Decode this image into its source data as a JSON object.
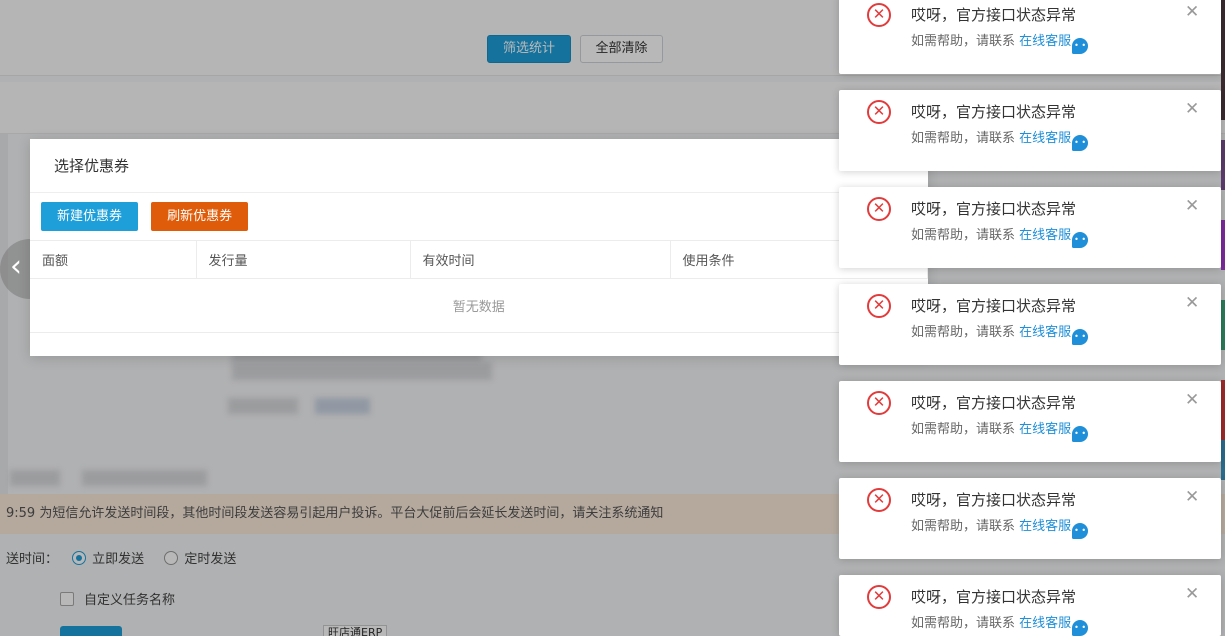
{
  "background": {
    "filter_button": "筛选统计",
    "clear_button": "全部清除",
    "notice_text": "9:59 为短信允许发送时间段，其他时间段发送容易引起用户投诉。平台大促前后会延长发送时间，请关注系统通知",
    "send_time_label": "送时间：",
    "send_now": "立即发送",
    "send_scheduled": "定时发送",
    "custom_task_name": "自定义任务名称",
    "erp_tag": "旺店通ERP"
  },
  "dialog": {
    "title": "选择优惠券",
    "new_button": "新建优惠券",
    "refresh_button": "刷新优惠券",
    "columns": [
      "面额",
      "发行量",
      "有效时间",
      "使用条件"
    ],
    "empty_text": "暂无数据"
  },
  "toasts": [
    {
      "title": "哎呀，官方接口状态异常",
      "help": "如需帮助，请联系",
      "link": "在线客服"
    },
    {
      "title": "哎呀，官方接口状态异常",
      "help": "如需帮助，请联系",
      "link": "在线客服"
    },
    {
      "title": "哎呀，官方接口状态异常",
      "help": "如需帮助，请联系",
      "link": "在线客服"
    },
    {
      "title": "哎呀，官方接口状态异常",
      "help": "如需帮助，请联系",
      "link": "在线客服"
    },
    {
      "title": "哎呀，官方接口状态异常",
      "help": "如需帮助，请联系",
      "link": "在线客服"
    },
    {
      "title": "哎呀，官方接口状态异常",
      "help": "如需帮助，请联系",
      "link": "在线客服"
    },
    {
      "title": "哎呀，官方接口状态异常",
      "help": "如需帮助，请联系",
      "link": "在线客服"
    }
  ],
  "icons": {
    "error": "error-circle-icon",
    "close": "close-icon",
    "chat": "chat-bubble-icon",
    "prev": "chevron-left-icon"
  },
  "colors": {
    "primary": "#1e9fda",
    "orange": "#de5c0a",
    "error": "#e23b3b",
    "link": "#1e8fd8",
    "notice_bg": "#fbeadb"
  }
}
